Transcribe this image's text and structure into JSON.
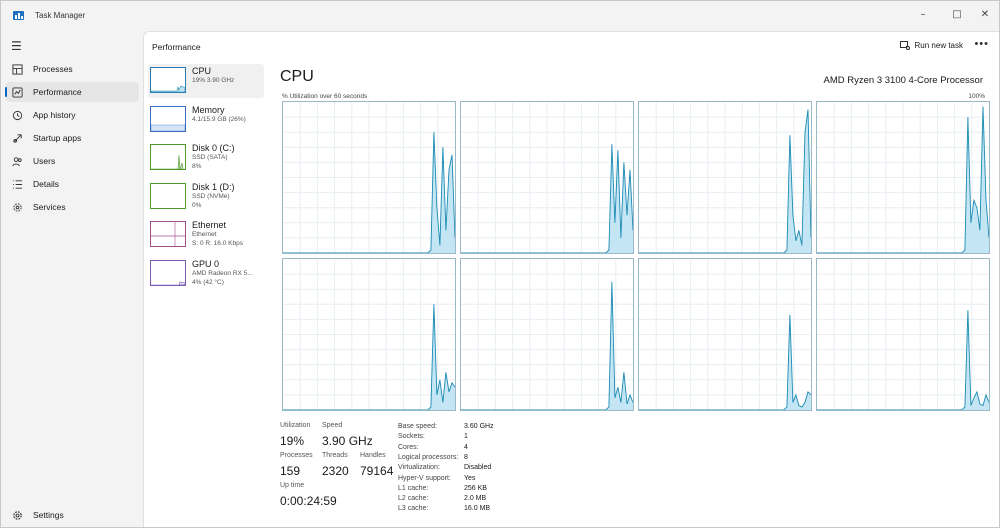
{
  "window": {
    "title": "Task Manager",
    "controls": [
      "–",
      "□",
      "✕"
    ]
  },
  "nav": {
    "items": [
      {
        "label": "Processes",
        "icon": "processes-icon"
      },
      {
        "label": "Performance",
        "icon": "performance-icon",
        "active": true
      },
      {
        "label": "App history",
        "icon": "history-icon"
      },
      {
        "label": "Startup apps",
        "icon": "startup-icon"
      },
      {
        "label": "Users",
        "icon": "users-icon"
      },
      {
        "label": "Details",
        "icon": "details-icon"
      },
      {
        "label": "Services",
        "icon": "services-icon"
      }
    ],
    "settings_label": "Settings"
  },
  "header": {
    "title": "Performance",
    "run_new_task": "Run new task",
    "more": "•••"
  },
  "devices": [
    {
      "name": "CPU",
      "sub1": "19%  3.90 GHz",
      "sub2": ""
    },
    {
      "name": "Memory",
      "sub1": "4.1/15.9 GB (26%)",
      "sub2": ""
    },
    {
      "name": "Disk 0 (C:)",
      "sub1": "SSD (SATA)",
      "sub2": "8%"
    },
    {
      "name": "Disk 1 (D:)",
      "sub1": "SSD (NVMe)",
      "sub2": "0%"
    },
    {
      "name": "Ethernet",
      "sub1": "Ethernet",
      "sub2": "S: 0  R: 16.0 Kbps"
    },
    {
      "name": "GPU 0",
      "sub1": "AMD Radeon RX 5...",
      "sub2": "4% (42 °C)"
    }
  ],
  "cpu": {
    "title": "CPU",
    "model": "AMD Ryzen 3 3100 4-Core Processor",
    "util_label": "% Utilization over 60 seconds",
    "max_label": "100%",
    "colors": {
      "line": "#1b8bb4",
      "fill": "#c4e6f4",
      "grid": "#e8eef2",
      "border": "#9ab8c8"
    },
    "cores": [
      [
        0,
        0,
        0,
        0,
        0,
        0,
        0,
        0,
        0,
        0,
        0,
        0,
        0,
        0,
        0,
        0,
        0,
        0,
        0,
        0,
        0,
        0,
        0,
        0,
        0,
        0,
        0,
        0,
        0,
        0,
        0,
        0,
        0,
        0,
        0,
        0,
        0,
        0,
        0,
        0,
        0,
        0,
        0,
        0,
        0,
        0,
        0,
        0,
        0,
        2,
        80,
        30,
        5,
        70,
        15,
        55,
        65,
        10
      ],
      [
        0,
        0,
        0,
        0,
        0,
        0,
        0,
        0,
        0,
        0,
        0,
        0,
        0,
        0,
        0,
        0,
        0,
        0,
        0,
        0,
        0,
        0,
        0,
        0,
        0,
        0,
        0,
        0,
        0,
        0,
        0,
        0,
        0,
        0,
        0,
        0,
        0,
        0,
        0,
        0,
        0,
        0,
        0,
        0,
        0,
        0,
        0,
        0,
        0,
        2,
        72,
        20,
        68,
        10,
        60,
        25,
        55,
        15
      ],
      [
        0,
        0,
        0,
        0,
        0,
        0,
        0,
        0,
        0,
        0,
        0,
        0,
        0,
        0,
        0,
        0,
        0,
        0,
        0,
        0,
        0,
        0,
        0,
        0,
        0,
        0,
        0,
        0,
        0,
        0,
        0,
        0,
        0,
        0,
        0,
        0,
        0,
        0,
        0,
        0,
        0,
        0,
        0,
        0,
        0,
        0,
        0,
        0,
        0,
        2,
        78,
        25,
        8,
        15,
        5,
        80,
        95,
        10
      ],
      [
        0,
        0,
        0,
        0,
        0,
        0,
        0,
        0,
        0,
        0,
        0,
        0,
        0,
        0,
        0,
        0,
        0,
        0,
        0,
        0,
        0,
        0,
        0,
        0,
        0,
        0,
        0,
        0,
        0,
        0,
        0,
        0,
        0,
        0,
        0,
        0,
        0,
        0,
        0,
        0,
        0,
        0,
        0,
        0,
        0,
        0,
        0,
        0,
        0,
        2,
        90,
        20,
        35,
        30,
        15,
        97,
        35,
        10
      ],
      [
        0,
        0,
        0,
        0,
        0,
        0,
        0,
        0,
        0,
        0,
        0,
        0,
        0,
        0,
        0,
        0,
        0,
        0,
        0,
        0,
        0,
        0,
        0,
        0,
        0,
        0,
        0,
        0,
        0,
        0,
        0,
        0,
        0,
        0,
        0,
        0,
        0,
        0,
        0,
        0,
        0,
        0,
        0,
        0,
        0,
        0,
        0,
        0,
        0,
        2,
        70,
        10,
        20,
        5,
        25,
        12,
        18,
        15
      ],
      [
        0,
        0,
        0,
        0,
        0,
        0,
        0,
        0,
        0,
        0,
        0,
        0,
        0,
        0,
        0,
        0,
        0,
        0,
        0,
        0,
        0,
        0,
        0,
        0,
        0,
        0,
        0,
        0,
        0,
        0,
        0,
        0,
        0,
        0,
        0,
        0,
        0,
        0,
        0,
        0,
        0,
        0,
        0,
        0,
        0,
        0,
        0,
        0,
        0,
        2,
        85,
        8,
        15,
        5,
        25,
        4,
        10,
        5
      ],
      [
        0,
        0,
        0,
        0,
        0,
        0,
        0,
        0,
        0,
        0,
        0,
        0,
        0,
        0,
        0,
        0,
        0,
        0,
        0,
        0,
        0,
        0,
        0,
        0,
        0,
        0,
        0,
        0,
        0,
        0,
        0,
        0,
        0,
        0,
        0,
        0,
        0,
        0,
        0,
        0,
        0,
        0,
        0,
        0,
        0,
        0,
        0,
        0,
        0,
        2,
        63,
        5,
        10,
        3,
        2,
        5,
        12,
        10
      ],
      [
        0,
        0,
        0,
        0,
        0,
        0,
        0,
        0,
        0,
        0,
        0,
        0,
        0,
        0,
        0,
        0,
        0,
        0,
        0,
        0,
        0,
        0,
        0,
        0,
        0,
        0,
        0,
        0,
        0,
        0,
        0,
        0,
        0,
        0,
        0,
        0,
        0,
        0,
        0,
        0,
        0,
        0,
        0,
        0,
        0,
        0,
        0,
        0,
        0,
        2,
        66,
        3,
        8,
        12,
        4,
        3,
        10,
        5
      ]
    ]
  },
  "stats": {
    "utilization": {
      "label": "Utilization",
      "value": "19%"
    },
    "speed": {
      "label": "Speed",
      "value": "3.90 GHz"
    },
    "processes": {
      "label": "Processes",
      "value": "159"
    },
    "threads": {
      "label": "Threads",
      "value": "2320"
    },
    "handles": {
      "label": "Handles",
      "value": "79164"
    },
    "uptime": {
      "label": "Up time",
      "value": "0:00:24:59"
    }
  },
  "specs": [
    {
      "k": "Base speed:",
      "v": "3.60 GHz"
    },
    {
      "k": "Sockets:",
      "v": "1"
    },
    {
      "k": "Cores:",
      "v": "4"
    },
    {
      "k": "Logical processors:",
      "v": "8"
    },
    {
      "k": "Virtualization:",
      "v": "Disabled"
    },
    {
      "k": "Hyper-V support:",
      "v": "Yes"
    },
    {
      "k": "L1 cache:",
      "v": "256 KB"
    },
    {
      "k": "L2 cache:",
      "v": "2.0 MB"
    },
    {
      "k": "L3 cache:",
      "v": "16.0 MB"
    }
  ]
}
